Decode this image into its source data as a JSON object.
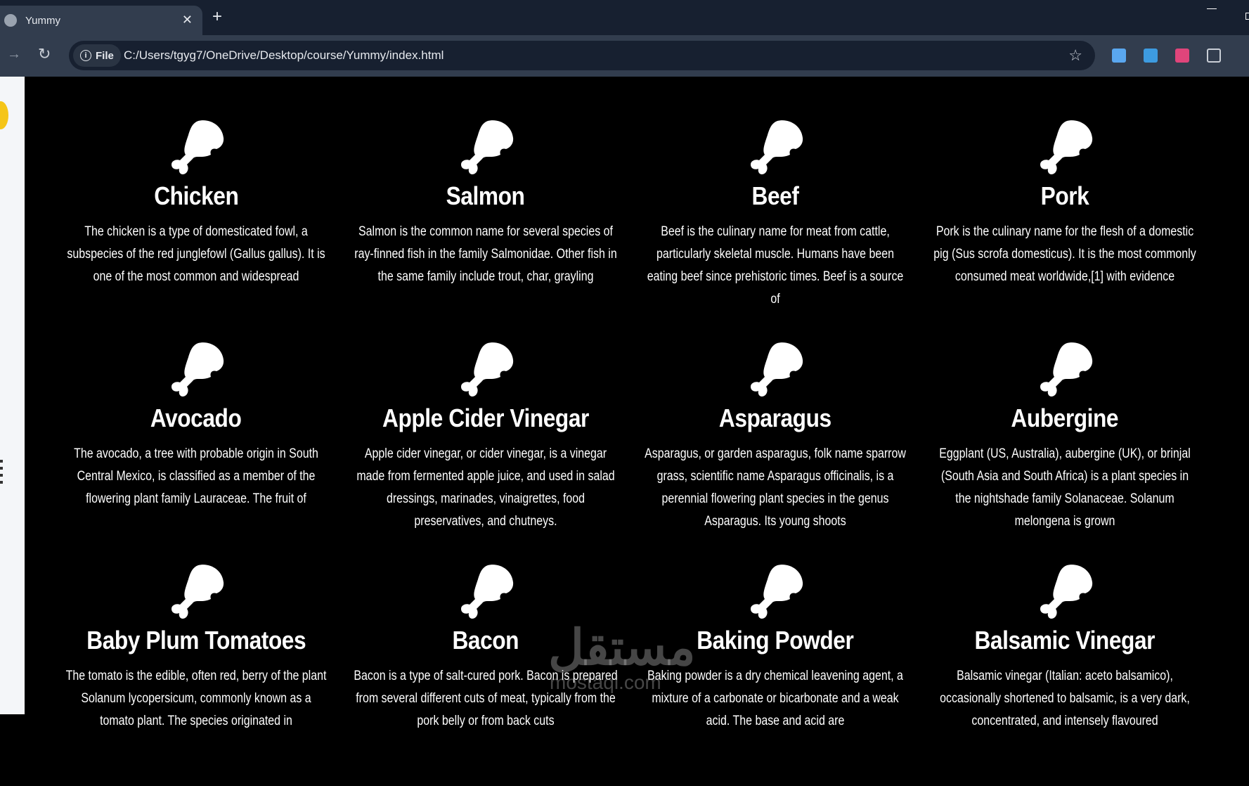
{
  "browser": {
    "tab_title": "Yummy",
    "url_chip": "File",
    "url": "C:/Users/tgyg7/OneDrive/Desktop/course/Yummy/index.html"
  },
  "meals": [
    {
      "name": "Chicken",
      "description": "The chicken is a type of domesticated fowl, a subspecies of the red junglefowl (Gallus gallus). It is one of the most common and widespread"
    },
    {
      "name": "Salmon",
      "description": "Salmon is the common name for several species of ray-finned fish in the family Salmonidae. Other fish in the same family include trout, char, grayling"
    },
    {
      "name": "Beef",
      "description": "Beef is the culinary name for meat from cattle, particularly skeletal muscle. Humans have been eating beef since prehistoric times. Beef is a source of"
    },
    {
      "name": "Pork",
      "description": "Pork is the culinary name for the flesh of a domestic pig (Sus scrofa domesticus). It is the most commonly consumed meat worldwide,[1] with evidence"
    },
    {
      "name": "Avocado",
      "description": "The avocado, a tree with probable origin in South Central Mexico, is classified as a member of the flowering plant family Lauraceae. The fruit of"
    },
    {
      "name": "Apple Cider Vinegar",
      "description": "Apple cider vinegar, or cider vinegar, is a vinegar made from fermented apple juice, and used in salad dressings, marinades, vinaigrettes, food preservatives, and chutneys."
    },
    {
      "name": "Asparagus",
      "description": "Asparagus, or garden asparagus, folk name sparrow grass, scientific name Asparagus officinalis, is a perennial flowering plant species in the genus Asparagus. Its young shoots"
    },
    {
      "name": "Aubergine",
      "description": "Eggplant (US, Australia), aubergine (UK), or brinjal (South Asia and South Africa) is a plant species in the nightshade family Solanaceae. Solanum melongena is grown"
    },
    {
      "name": "Baby Plum Tomatoes",
      "description": "The tomato is the edible, often red, berry of the plant Solanum lycopersicum, commonly known as a tomato plant. The species originated in"
    },
    {
      "name": "Bacon",
      "description": "Bacon is a type of salt-cured pork. Bacon is prepared from several different cuts of meat, typically from the pork belly or from back cuts"
    },
    {
      "name": "Baking Powder",
      "description": "Baking powder is a dry chemical leavening agent, a mixture of a carbonate or bicarbonate and a weak acid. The base and acid are"
    },
    {
      "name": "Balsamic Vinegar",
      "description": "Balsamic vinegar (Italian: aceto balsamico), occasionally shortened to balsamic, is a very dark, concentrated, and intensely flavoured"
    }
  ],
  "watermark": {
    "arabic": "مستقل",
    "latin": "mostaql.com"
  },
  "icons": {
    "meal": "drumstick-bite-icon"
  }
}
